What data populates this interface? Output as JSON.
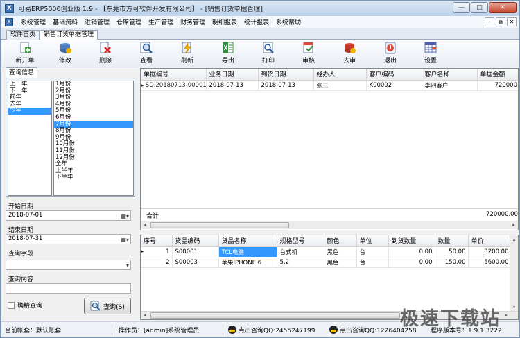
{
  "window": {
    "title": "可易ERP5000创业版 1.9 - 【东莞市方可软件开发有限公司】 - [销售订货单据管理]",
    "app_icon_glyph": "X"
  },
  "window_buttons": {
    "minimize": "—",
    "maximize": "□",
    "close": "✕"
  },
  "menubar": {
    "items": [
      "系统管理",
      "基础资料",
      "进销管理",
      "仓库管理",
      "生产管理",
      "财务管理",
      "明细报表",
      "统计报表",
      "系统帮助"
    ],
    "mdi_buttons": [
      "–",
      "⧉",
      "✕"
    ]
  },
  "tabs": [
    "软件首页",
    "销售订货单据管理"
  ],
  "toolbar": {
    "buttons": [
      {
        "label": "新开单",
        "icon": "new-doc-icon"
      },
      {
        "label": "修改",
        "icon": "edit-icon"
      },
      {
        "label": "删除",
        "icon": "delete-icon"
      },
      {
        "label": "查看",
        "icon": "view-icon"
      },
      {
        "label": "刷新",
        "icon": "refresh-icon"
      },
      {
        "label": "导出",
        "icon": "export-excel-icon"
      },
      {
        "label": "打印",
        "icon": "print-icon"
      },
      {
        "label": "审核",
        "icon": "audit-icon"
      },
      {
        "label": "去审",
        "icon": "unaudit-icon"
      },
      {
        "label": "退出",
        "icon": "exit-icon"
      },
      {
        "label": "设置",
        "icon": "settings-icon"
      }
    ]
  },
  "query": {
    "tab_label": "查询信息",
    "year_list": [
      "上一年",
      "下一年",
      "前年",
      "去年",
      "今年"
    ],
    "year_selected": "今年",
    "month_list": [
      "1月份",
      "2月份",
      "3月份",
      "4月份",
      "5月份",
      "6月份",
      "7月份",
      "8月份",
      "9月份",
      "10月份",
      "11月份",
      "12月份",
      "全年",
      "上半年",
      "下半年"
    ],
    "month_selected": "7月份",
    "start_date_label": "开始日期",
    "start_date": "2018-07-01",
    "end_date_label": "结束日期",
    "end_date": "2018-07-31",
    "field_label": "查询字段",
    "field_value": "",
    "content_label": "查询内容",
    "content_value": "",
    "exact_label": "确精查询",
    "exact_checked": false,
    "search_button": "查询(S)"
  },
  "orders": {
    "columns": [
      "单据编号",
      "业务日期",
      "到货日期",
      "经办人",
      "客户编码",
      "客户名称",
      "单据金额"
    ],
    "rows": [
      {
        "no": "SD.20180713-00001",
        "biz_date": "2018-07-13",
        "arrive_date": "2018-07-13",
        "handler": "张三",
        "cust_code": "K00002",
        "cust_name": "李四客户",
        "amount": "720000.00"
      }
    ],
    "total_label": "合计",
    "total_amount": "720000.00"
  },
  "items": {
    "columns": [
      "序号",
      "货品编码",
      "货品名称",
      "规格型号",
      "颜色",
      "单位",
      "到货数量",
      "数量",
      "单价"
    ],
    "rows": [
      {
        "seq": "1",
        "code": "S00001",
        "name": "TCL电脑",
        "spec": "台式机",
        "color": "黑色",
        "unit": "台",
        "arrived": "0.00",
        "qty": "50.00",
        "price": "3200.00"
      },
      {
        "seq": "2",
        "code": "S00003",
        "name": "苹果IPHONE 6",
        "spec": "5.2",
        "color": "黑色",
        "unit": "台",
        "arrived": "0.00",
        "qty": "150.00",
        "price": "5600.00"
      }
    ]
  },
  "status": {
    "account": "当前帐套：默认账套",
    "operator": "操作员：[admin]系统管理员",
    "qq1": "点击咨询QQ:2455247199",
    "qq2": "点击咨询QQ:1226404258",
    "version": "程序版本号：1.9.1.3222"
  },
  "watermark": "极速下载站"
}
